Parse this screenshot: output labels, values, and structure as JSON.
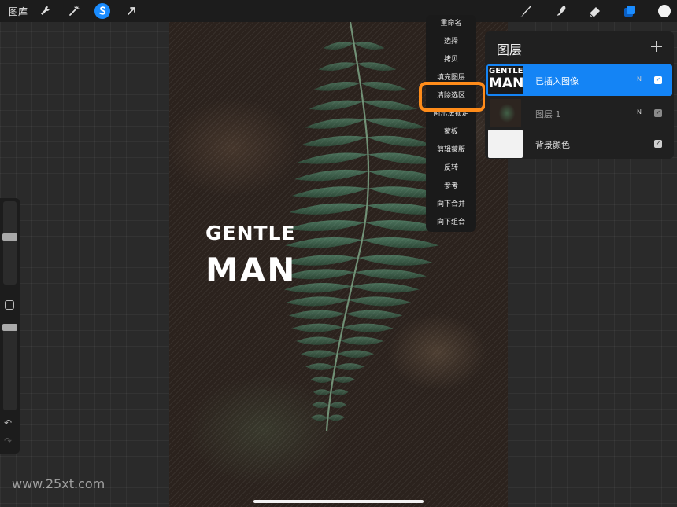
{
  "toolbar": {
    "gallery_label": "图库",
    "tools_left": [
      "wrench-icon",
      "magic-wand-icon",
      "selection-icon",
      "transform-arrow-icon"
    ],
    "tools_right": [
      "brush-icon",
      "smudge-icon",
      "eraser-icon",
      "layers-icon",
      "color-swatch-icon"
    ],
    "accent": "#1a8cff"
  },
  "canvas": {
    "text_line_1": "GENTLE",
    "text_line_2": "MAN"
  },
  "context_menu": {
    "items": [
      "重命名",
      "选择",
      "拷贝",
      "填充图层",
      "清除选区",
      "阿尔法锁定",
      "蒙板",
      "剪辑蒙版",
      "反转",
      "参考",
      "向下合并",
      "向下组合"
    ],
    "highlighted": "清除选区",
    "highlight_color": "#ff8c1a"
  },
  "layers_panel": {
    "title": "图层",
    "add_icon": "plus-icon",
    "layers": [
      {
        "name": "已插入图像",
        "blend": "N",
        "visible": true,
        "selected": true,
        "thumb_line_1": "GENTLE",
        "thumb_line_2": "MAN"
      },
      {
        "name": "图层 1",
        "blend": "N",
        "visible": true,
        "selected": false
      },
      {
        "name": "背景颜色",
        "blend": "",
        "visible": true,
        "selected": false
      }
    ],
    "selected_color": "#1484f5"
  },
  "sidebar": {
    "brush_size_level": 0.42,
    "opacity_level": 0.0,
    "undo_icon": "undo-icon",
    "redo_icon": "redo-icon"
  },
  "watermark": "www.25xt.com"
}
